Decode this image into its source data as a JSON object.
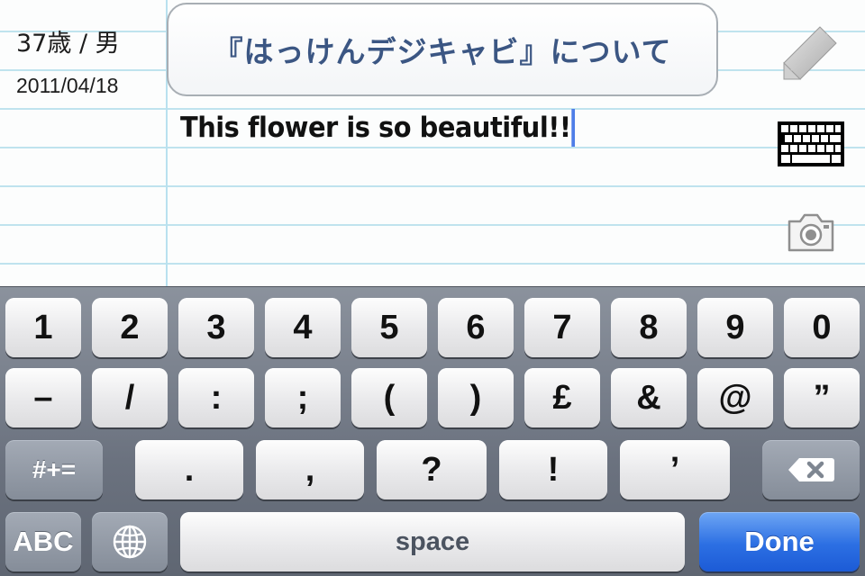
{
  "note": {
    "age_gender": "37歳 / 男",
    "date": "2011/04/18",
    "about_button_label": "『はっけんデジキャビ』について",
    "text": "This flower is so beautiful!!"
  },
  "icons": {
    "pencil": "pencil-icon",
    "keyboard": "keyboard-icon",
    "camera": "camera-icon",
    "globe": "globe-icon",
    "backspace": "backspace-icon"
  },
  "keyboard": {
    "row1": [
      "1",
      "2",
      "3",
      "4",
      "5",
      "6",
      "7",
      "8",
      "9",
      "0"
    ],
    "row2": [
      "–",
      "/",
      ":",
      ";",
      "(",
      ")",
      "£",
      "&",
      "@",
      "”"
    ],
    "row3": [
      ".",
      ",",
      "?",
      "!",
      "’"
    ],
    "symbols_toggle": "#+=",
    "abc_toggle": "ABC",
    "space_label": "space",
    "done_label": "Done"
  },
  "colors": {
    "title_blue": "#3b5683",
    "cursor_blue": "#4e7de8",
    "done_blue": "#2c6fe3",
    "rule_line": "#bfe3ee"
  }
}
